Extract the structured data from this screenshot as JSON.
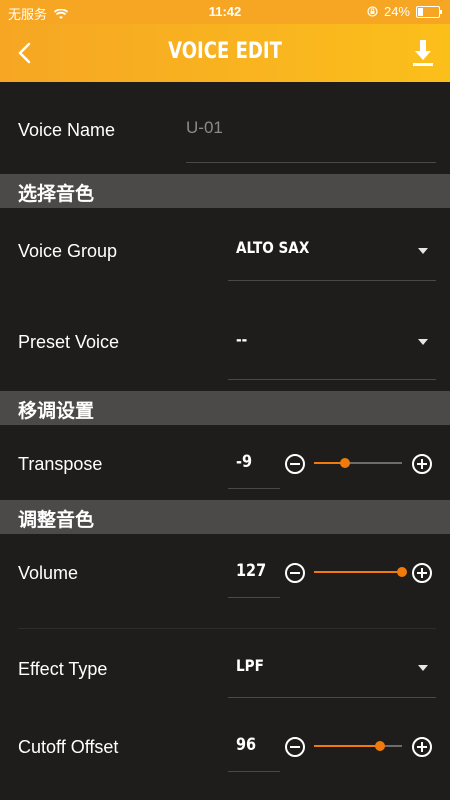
{
  "status_bar": {
    "carrier": "无服务",
    "time": "11:42",
    "battery": "24%"
  },
  "header": {
    "title": "VOICE EDIT"
  },
  "voice_name": {
    "label": "Voice Name",
    "value": "U-01"
  },
  "sections": {
    "select_voice": "选择音色",
    "transpose": "移调设置",
    "adjust_voice": "调整音色"
  },
  "voice_group": {
    "label": "Voice Group",
    "value": "ALTO SAX"
  },
  "preset_voice": {
    "label": "Preset Voice",
    "value": "--"
  },
  "transpose": {
    "label": "Transpose",
    "value": "-9",
    "level": 0.35
  },
  "volume": {
    "label": "Volume",
    "value": "127",
    "level": 1.0
  },
  "effect_type": {
    "label": "Effect Type",
    "value": "LPF"
  },
  "cutoff_offset": {
    "label": "Cutoff Offset",
    "value": "96",
    "level": 0.75
  },
  "colors": {
    "accent": "#f07a0c",
    "header": "#f6a623",
    "background": "#1e1d1b",
    "section": "#4b4a48"
  }
}
